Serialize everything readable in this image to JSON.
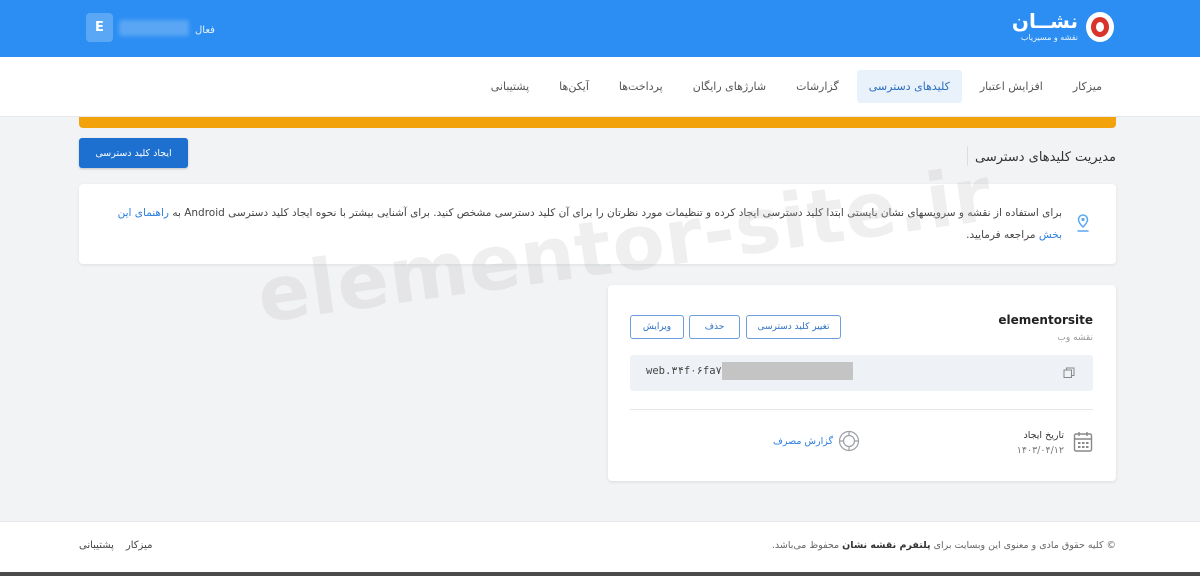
{
  "header": {
    "logo_title": "نشــان",
    "logo_subtitle": "نقشه و مسیریاب",
    "user_initial": "E",
    "user_status": "فعال"
  },
  "nav": {
    "items": [
      {
        "label": "میزکار",
        "active": false
      },
      {
        "label": "افزایش اعتبار",
        "active": false
      },
      {
        "label": "کلیدهای دسترسی",
        "active": true
      },
      {
        "label": "گزارشات",
        "active": false
      },
      {
        "label": "شارژهای رایگان",
        "active": false
      },
      {
        "label": "پرداخت‌ها",
        "active": false
      },
      {
        "label": "آیکن‌ها",
        "active": false
      },
      {
        "label": "پشتیبانی",
        "active": false
      }
    ]
  },
  "page": {
    "title": "مدیریت کلیدهای دسترسی",
    "create_button": "ایجاد کلید دسترسی"
  },
  "info": {
    "text": "برای استفاده از نقشه و سرویسهای نشان بایستی ابتدا کلید دسترسی ایجاد کرده و تنظیمات مورد نظرتان را برای آن کلید دسترسی مشخص کنید. برای آشنایی بیشتر با نحوه ایجاد کلید دسترسی Android به",
    "link": "راهنمای این بخش",
    "text_end": "مراجعه فرمایید."
  },
  "key_card": {
    "name": "elementorsite",
    "type": "نقشه وب",
    "change_button": "تغییر کلید دسترسی",
    "delete_button": "حذف",
    "edit_button": "ویرایش",
    "key_value": "web.۳۴f۰۶fa۷ea",
    "date_label": "تاریخ ایجاد",
    "date_value": "۱۴۰۳/۰۴/۱۲",
    "report_link": "گزارش مصرف"
  },
  "watermark": "elementor-site.ir",
  "footer": {
    "copyright_prefix": "© کلیه حقوق مادی و معنوی این وبسایت برای",
    "copyright_brand": "پلتفرم نقشه نشان",
    "copyright_suffix": "محفوظ می‌باشد.",
    "link_dashboard": "میزکار",
    "link_support": "پشتیبانی"
  },
  "colors": {
    "header_blue": "#2c8ef2",
    "primary_button": "#1d6fd0",
    "warning_strip": "#f2a20a",
    "link": "#2a7de1"
  }
}
